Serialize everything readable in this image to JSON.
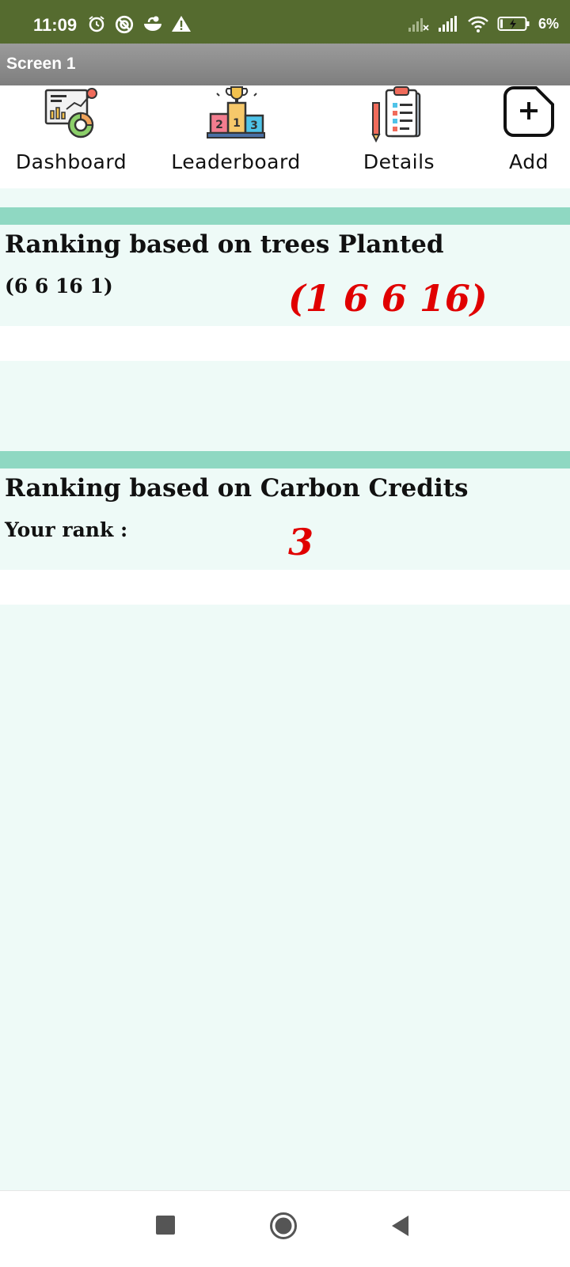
{
  "status_bar": {
    "time": "11:09",
    "battery_percent": "6%",
    "left_icons": [
      "alarm-icon",
      "sync-icon",
      "app-icon",
      "warning-icon"
    ],
    "right_icons": [
      "signal-off-icon",
      "signal-icon",
      "wifi-icon",
      "battery-icon"
    ],
    "color": "#556b2f"
  },
  "title_bar": {
    "title": "Screen 1"
  },
  "toolbar": {
    "items": [
      {
        "label": "Dashboard",
        "icon": "dashboard-icon"
      },
      {
        "label": "Leaderboard",
        "icon": "podium-icon"
      },
      {
        "label": "Details",
        "icon": "clipboard-icon"
      },
      {
        "label": "Add",
        "icon": "add-icon"
      }
    ]
  },
  "sections": {
    "trees": {
      "title": "Ranking based on trees Planted",
      "subtitle": "(6 6 16 1)",
      "value": "(1 6 6 16)"
    },
    "carbon": {
      "title": "Ranking based on Carbon Credits",
      "subtitle": "Your rank :",
      "value": "3"
    }
  },
  "colors": {
    "accent_bar": "#8fd8c2",
    "background": "#eefaf7",
    "highlight_text": "#e00000"
  },
  "nav_bar": {
    "buttons": [
      "recent-apps-icon",
      "home-icon",
      "back-icon"
    ]
  }
}
